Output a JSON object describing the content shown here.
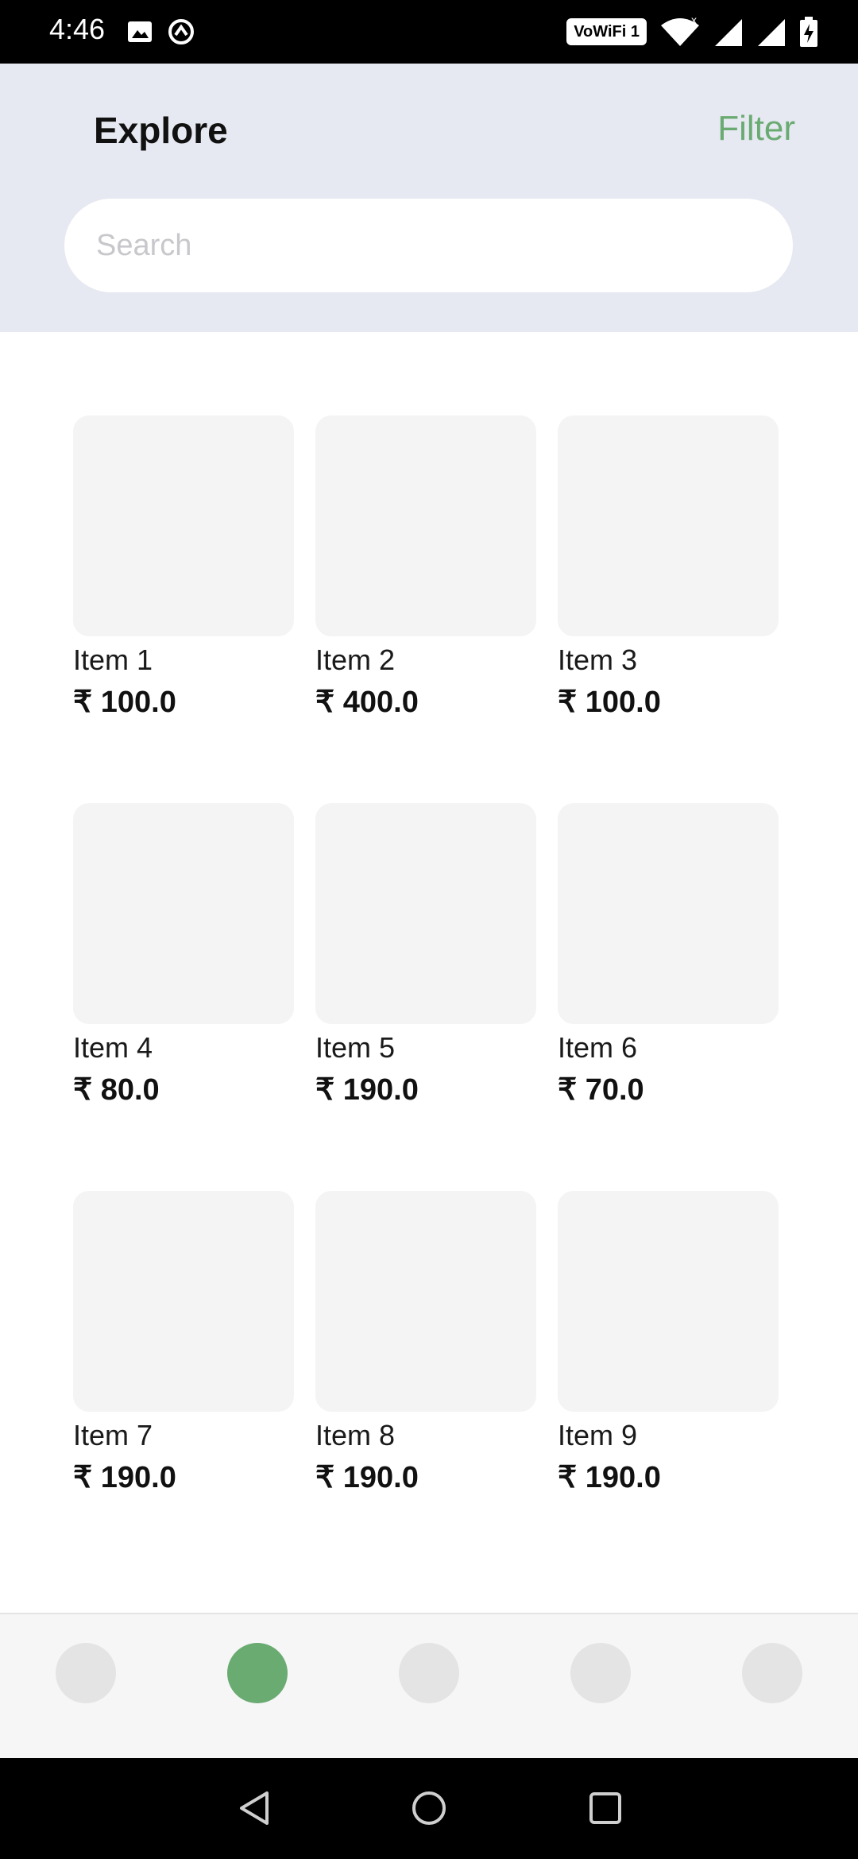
{
  "status_bar": {
    "time": "4:46",
    "network_badge": "VoWiFi 1",
    "icons": [
      "image-icon",
      "sync-icon",
      "wifi-icon",
      "signal-icon",
      "signal-icon",
      "battery-charging-icon"
    ]
  },
  "header": {
    "title": "Explore",
    "filter_label": "Filter"
  },
  "search": {
    "placeholder": "Search",
    "value": ""
  },
  "items": [
    {
      "name": "Item 1",
      "price": "₹ 100.0"
    },
    {
      "name": "Item 2",
      "price": "₹ 400.0"
    },
    {
      "name": "Item 3",
      "price": "₹ 100.0"
    },
    {
      "name": "Item 4",
      "price": "₹ 80.0"
    },
    {
      "name": "Item 5",
      "price": "₹ 190.0"
    },
    {
      "name": "Item 6",
      "price": "₹ 70.0"
    },
    {
      "name": "Item 7",
      "price": "₹ 190.0"
    },
    {
      "name": "Item 8",
      "price": "₹ 190.0"
    },
    {
      "name": "Item 9",
      "price": "₹ 190.0"
    }
  ],
  "bottom_nav": {
    "active_index": 1,
    "count": 5
  },
  "colors": {
    "accent": "#6aab72",
    "header_bg": "#e6e8f2",
    "thumb_bg": "#f4f4f4",
    "nav_inactive": "#e4e4e4"
  },
  "system_nav": {
    "buttons": [
      "back-icon",
      "home-icon",
      "recents-icon"
    ]
  }
}
